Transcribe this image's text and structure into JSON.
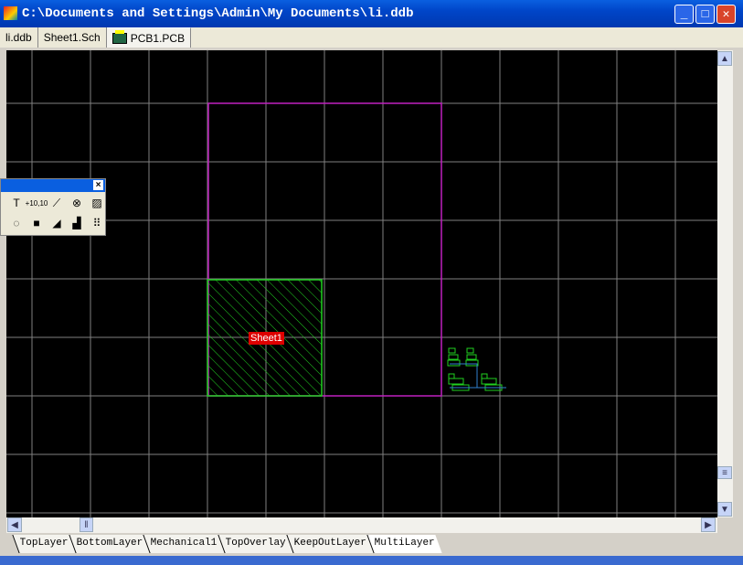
{
  "window": {
    "title": "C:\\Documents and Settings\\Admin\\My Documents\\li.ddb",
    "minimize": "_",
    "maximize": "□",
    "close": "✕"
  },
  "tabs": [
    {
      "label": "li.ddb"
    },
    {
      "label": "Sheet1.Sch"
    },
    {
      "label": "PCB1.PCB"
    }
  ],
  "toolbox": {
    "close": "×",
    "tools": [
      {
        "name": "string",
        "glyph": "T"
      },
      {
        "name": "coordinate",
        "glyph": "+10,10"
      },
      {
        "name": "dimension",
        "glyph": "⟋"
      },
      {
        "name": "via-mark",
        "glyph": "⊗"
      },
      {
        "name": "hatched-fill",
        "glyph": "▨"
      },
      {
        "name": "arc",
        "glyph": "◌"
      },
      {
        "name": "fill",
        "glyph": "■"
      },
      {
        "name": "polygon",
        "glyph": "◢"
      },
      {
        "name": "split-plane",
        "glyph": "▟"
      },
      {
        "name": "array",
        "glyph": "⠿"
      }
    ]
  },
  "board": {
    "sheet_label": "Sheet1"
  },
  "layers": [
    {
      "label": "TopLayer"
    },
    {
      "label": "BottomLayer"
    },
    {
      "label": "Mechanical1"
    },
    {
      "label": "TopOverlay"
    },
    {
      "label": "KeepOutLayer"
    },
    {
      "label": "MultiLayer"
    }
  ],
  "colors": {
    "grid": "#808080",
    "board_outline": "#c020c0",
    "room": "#20d020",
    "label_bg": "#d00000"
  }
}
